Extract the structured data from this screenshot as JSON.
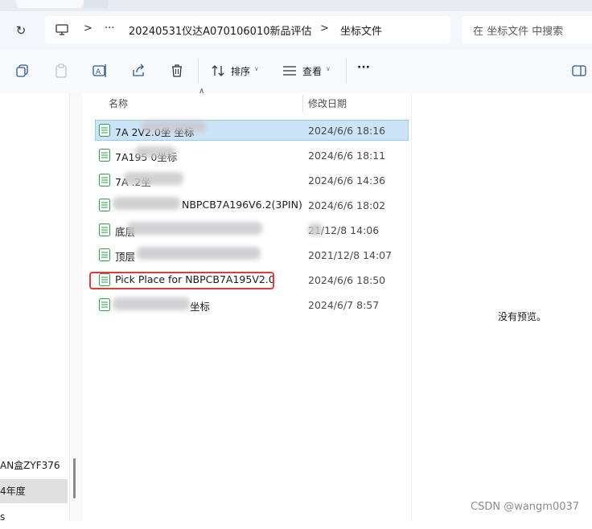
{
  "address": {
    "breadcrumb": [
      "20240531仪达A070106010新品评估",
      "坐标文件"
    ],
    "overflow": "···",
    "separator": ">",
    "search_placeholder": "在 坐标文件 中搜索"
  },
  "toolbar": {
    "sort_label": "排序",
    "view_label": "查看",
    "more_label": "···"
  },
  "nav": {
    "items": [
      {
        "label": "AN盒ZYF376",
        "selected": false
      },
      {
        "label": "4年度",
        "selected": true
      },
      {
        "label": "s",
        "selected": false
      }
    ]
  },
  "columns": {
    "name": "名称",
    "date": "修改日期"
  },
  "files": [
    {
      "name": "7A  2V2.0坐   坐标",
      "date": "2024/6/6 18:16",
      "selected": true
    },
    {
      "name": "7A195   0坐标",
      "date": "2024/6/6 18:11",
      "selected": false
    },
    {
      "name": "7A   .2坐",
      "date": "2024/6/6 14:36",
      "selected": false
    },
    {
      "name": "NBPCB7A196V6.2(3PIN)",
      "date": "2024/6/6 18:02",
      "selected": false
    },
    {
      "name": "底层",
      "date": "  21/12/8 14:06",
      "selected": false
    },
    {
      "name": "顶层",
      "date": "2021/12/8 14:07",
      "selected": false
    },
    {
      "name": "Pick Place for NBPCB7A195V2.0",
      "date": "2024/6/6 18:50",
      "selected": false,
      "highlighted": true
    },
    {
      "name": "坐标",
      "date": "2024/6/7 8:57",
      "selected": false
    }
  ],
  "preview": {
    "empty_text": "没有预览。"
  },
  "watermark": "CSDN @wangm0037",
  "colors": {
    "selection": "#cce4f7",
    "highlight_box": "#e53935",
    "file_icon": "#2e9d4a"
  }
}
